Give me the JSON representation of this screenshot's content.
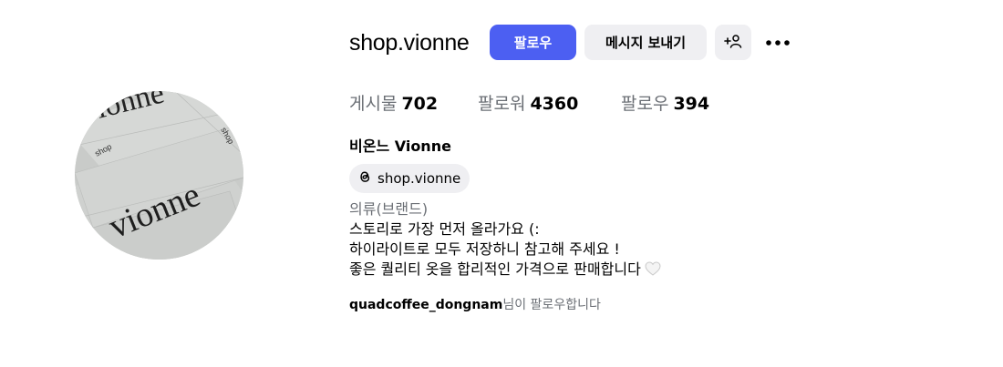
{
  "profile": {
    "username": "shop.vionne",
    "display_name": "비온느 Vionne",
    "threads_handle": "shop.vionne",
    "category": "의류(브랜드)",
    "bio_lines": [
      "스토리로 가장 먼저 올라가요 (:",
      "하이라이트로 모두 저장하니 참고해 주세요 !",
      "좋은 퀄리티 옷을 합리적인 가격으로 판매합니다"
    ],
    "followed_by_user": "quadcoffee_dongnam",
    "followed_by_suffix": "님이 팔로우합니다"
  },
  "avatar": {
    "card_texts": [
      "vionne",
      "shop",
      "shop",
      "vionne"
    ]
  },
  "actions": {
    "follow_label": "팔로우",
    "message_label": "메시지 보내기",
    "suggest_icon": "add-person-icon",
    "more_icon": "more-horizontal-icon"
  },
  "stats": {
    "posts_label": "게시물",
    "posts_value": "702",
    "followers_label": "팔로워",
    "followers_value": "4360",
    "following_label": "팔로우",
    "following_value": "394"
  },
  "colors": {
    "accent": "#4c5ff2",
    "secondary_button": "#efeff2",
    "muted_text": "#6b6f75"
  }
}
